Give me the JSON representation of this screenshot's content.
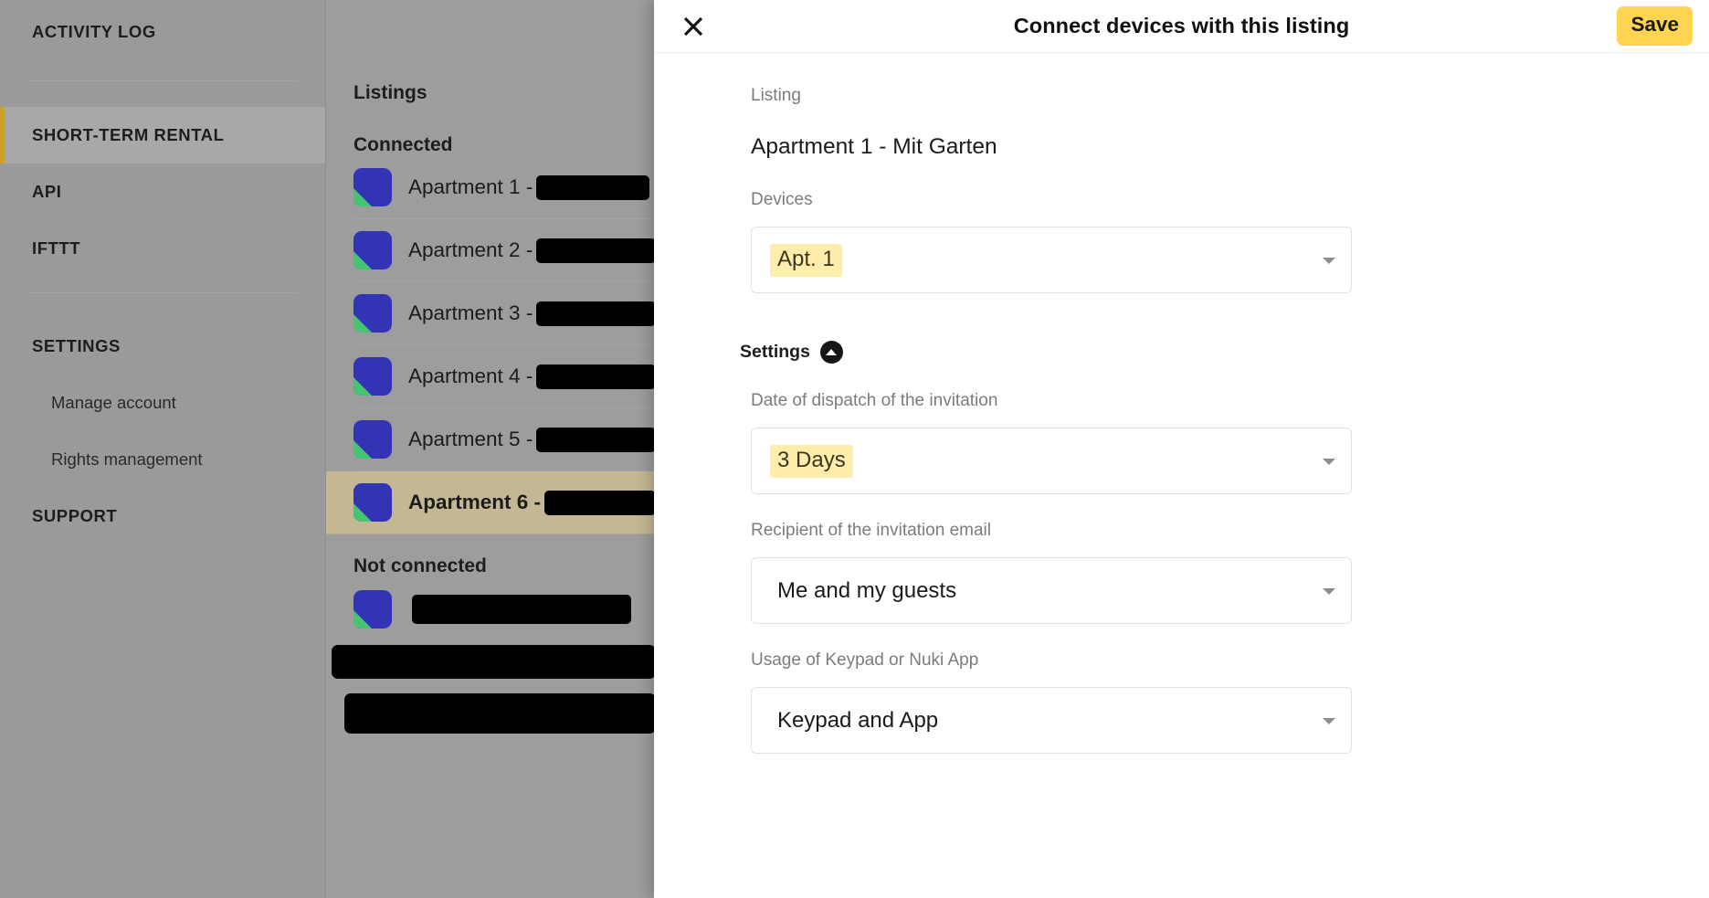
{
  "sidebar": {
    "items": [
      {
        "label": "ACTIVITY LOG",
        "type": "section",
        "active": false
      },
      {
        "label": "SHORT-TERM RENTAL",
        "type": "section",
        "active": true
      },
      {
        "label": "API",
        "type": "section",
        "active": false
      },
      {
        "label": "IFTTT",
        "type": "section",
        "active": false
      },
      {
        "label": "SETTINGS",
        "type": "section",
        "active": false
      },
      {
        "label": "Manage account",
        "type": "sub",
        "active": false
      },
      {
        "label": "Rights management",
        "type": "sub",
        "active": false
      },
      {
        "label": "SUPPORT",
        "type": "section",
        "active": false
      }
    ],
    "accent_color": "#c9a227",
    "background_color": "#9a9a9a"
  },
  "listings_panel": {
    "title": "Listings",
    "group_connected_label": "Connected",
    "group_not_connected_label": "Not connected",
    "connected": [
      {
        "label": "Apartment 1 -",
        "redacted_width": 124,
        "selected": false,
        "icon": "nuki-listing-icon"
      },
      {
        "label": "Apartment 2 -",
        "redacted_width": 138,
        "selected": false,
        "icon": "nuki-listing-icon"
      },
      {
        "label": "Apartment 3 -",
        "redacted_width": 132,
        "selected": false,
        "icon": "nuki-listing-icon"
      },
      {
        "label": "Apartment 4 -",
        "redacted_width": 131,
        "selected": false,
        "icon": "nuki-listing-icon"
      },
      {
        "label": "Apartment 5 -",
        "redacted_width": 132,
        "selected": false,
        "icon": "nuki-listing-icon"
      },
      {
        "label": "Apartment 6 -",
        "redacted_width": 130,
        "selected": true,
        "icon": "nuki-listing-icon"
      }
    ],
    "not_connected": [
      {
        "label": "",
        "redacted_width": 270,
        "icon": "nuki-listing-icon"
      },
      {
        "label": "",
        "redacted_width": 360,
        "icon": "none"
      },
      {
        "label": "",
        "redacted_width": 355,
        "icon": "none"
      }
    ],
    "selected_highlight_color": "#c4b894",
    "icon_colors": {
      "primary": "#3333b5",
      "accent": "#45c472"
    }
  },
  "modal": {
    "title": "Connect devices with this listing",
    "close_label": "close-icon",
    "save_label": "Save",
    "save_color": "#ffd451",
    "fields": {
      "listing_label": "Listing",
      "listing_value": "Apartment 1 - Mit Garten",
      "devices_label": "Devices",
      "devices_chip": "Apt. 1",
      "settings_label": "Settings",
      "dispatch_label": "Date of dispatch of the invitation",
      "dispatch_value": "3 Days",
      "recipient_label": "Recipient of the invitation email",
      "recipient_value": "Me and my guests",
      "usage_label": "Usage of Keypad or Nuki App",
      "usage_value": "Keypad and App"
    },
    "highlight_color": "#ffeeab"
  }
}
